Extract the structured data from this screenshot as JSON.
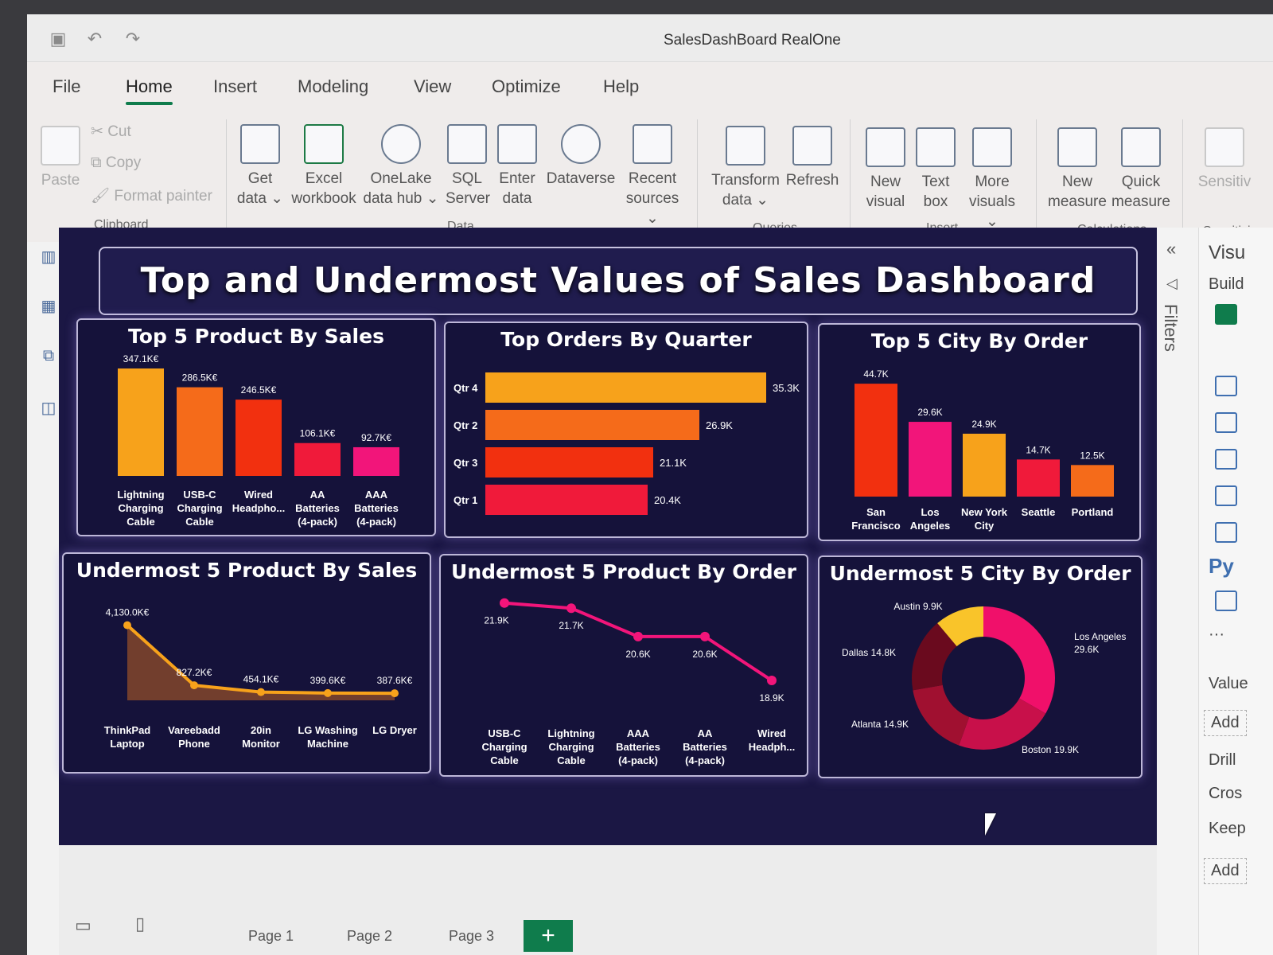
{
  "window": {
    "title": "SalesDashBoard RealOne"
  },
  "menu": [
    "File",
    "Home",
    "Insert",
    "Modeling",
    "View",
    "Optimize",
    "Help"
  ],
  "ribbon": {
    "clipboard": {
      "paste": "Paste",
      "cut": "Cut",
      "copy": "Copy",
      "format_painter": "Format painter",
      "label": "Clipboard"
    },
    "data": {
      "buttons": [
        {
          "l1": "Get",
          "l2": "data ⌄"
        },
        {
          "l1": "Excel",
          "l2": "workbook"
        },
        {
          "l1": "OneLake",
          "l2": "data hub ⌄"
        },
        {
          "l1": "SQL",
          "l2": "Server"
        },
        {
          "l1": "Enter",
          "l2": "data"
        },
        {
          "l1": "Dataverse",
          "l2": ""
        },
        {
          "l1": "Recent",
          "l2": "sources ⌄"
        }
      ],
      "label": "Data"
    },
    "queries": {
      "buttons": [
        {
          "l1": "Transform",
          "l2": "data ⌄"
        },
        {
          "l1": "Refresh",
          "l2": ""
        }
      ],
      "label": "Queries"
    },
    "insert": {
      "buttons": [
        {
          "l1": "New",
          "l2": "visual"
        },
        {
          "l1": "Text",
          "l2": "box"
        },
        {
          "l1": "More",
          "l2": "visuals ⌄"
        }
      ],
      "label": "Insert"
    },
    "calculations": {
      "buttons": [
        {
          "l1": "New",
          "l2": "measure"
        },
        {
          "l1": "Quick",
          "l2": "measure"
        }
      ],
      "label": "Calculations"
    },
    "sensitivity": {
      "button": "Sensitiv",
      "label": "Sensitivi"
    }
  },
  "dashboard": {
    "title": "Top and Undermost Values of Sales Dashboard",
    "cards": {
      "top_products": "Top 5 Product By Sales",
      "top_orders_quarter": "Top Orders By Quarter",
      "top_city": "Top 5 City By Order",
      "under_products_sales": "Undermost 5 Product By Sales",
      "under_products_order": "Undermost 5 Product By Order",
      "under_city": "Undermost 5 City By Order"
    }
  },
  "chart_data": [
    {
      "type": "bar",
      "title": "Top 5 Product By Sales",
      "categories": [
        "Lightning Charging Cable",
        "USB-C Charging Cable",
        "Wired Headpho...",
        "AA Batteries (4-pack)",
        "AAA Batteries (4-pack)"
      ],
      "values": [
        347.1,
        286.5,
        246.5,
        106.1,
        92.7
      ],
      "data_labels": [
        "347.1K€",
        "286.5K€",
        "246.5K€",
        "106.1K€",
        "92.7K€"
      ],
      "colors": [
        "#f7a21b",
        "#f56b1a",
        "#f2300f",
        "#f01a3a",
        "#f2157a"
      ],
      "ylim": [
        0,
        360
      ]
    },
    {
      "type": "bar",
      "orientation": "horizontal",
      "title": "Top Orders By Quarter",
      "categories": [
        "Qtr 4",
        "Qtr 2",
        "Qtr 3",
        "Qtr 1"
      ],
      "values": [
        35.3,
        26.9,
        21.1,
        20.4
      ],
      "data_labels": [
        "35.3K",
        "26.9K",
        "21.1K",
        "20.4K"
      ],
      "colors": [
        "#f7a21b",
        "#f56b1a",
        "#f2300f",
        "#f01a3a"
      ],
      "xlim": [
        0,
        36
      ]
    },
    {
      "type": "bar",
      "title": "Top 5 City By Order",
      "categories": [
        "San Francisco",
        "Los Angeles",
        "New York City",
        "Seattle",
        "Portland"
      ],
      "values": [
        44.7,
        29.6,
        24.9,
        14.7,
        12.5
      ],
      "data_labels": [
        "44.7K",
        "29.6K",
        "24.9K",
        "14.7K",
        "12.5K"
      ],
      "colors": [
        "#f2300f",
        "#f2157a",
        "#f7a21b",
        "#f01a3a",
        "#f56b1a"
      ],
      "ylim": [
        0,
        46
      ]
    },
    {
      "type": "area",
      "title": "Undermost 5 Product By Sales",
      "categories": [
        "ThinkPad Laptop",
        "Vareebadd Phone",
        "20in Monitor",
        "LG Washing Machine",
        "LG Dryer"
      ],
      "values": [
        4130.0,
        827.2,
        454.1,
        399.6,
        387.6
      ],
      "data_labels": [
        "4,130.0K€",
        "827.2K€",
        "454.1K€",
        "399.6K€",
        "387.6K€"
      ],
      "colors": [
        "#f7a21b"
      ],
      "ylim": [
        0,
        4200
      ]
    },
    {
      "type": "line",
      "title": "Undermost 5 Product By Order",
      "categories": [
        "USB-C Charging Cable",
        "Lightning Charging Cable",
        "AAA Batteries (4-pack)",
        "AA Batteries (4-pack)",
        "Wired Headph..."
      ],
      "values": [
        21.9,
        21.7,
        20.6,
        20.6,
        18.9
      ],
      "data_labels": [
        "21.9K",
        "21.7K",
        "20.6K",
        "20.6K",
        "18.9K"
      ],
      "colors": [
        "#f2157a"
      ],
      "ylim": [
        18.5,
        22.2
      ]
    },
    {
      "type": "pie",
      "title": "Undermost 5 City By Order",
      "labels": [
        "Los Angeles",
        "Boston",
        "Atlanta",
        "Dallas",
        "Austin"
      ],
      "values": [
        29.6,
        19.9,
        14.9,
        14.8,
        9.9
      ],
      "data_labels": [
        "Los Angeles 29.6K",
        "Boston 19.9K",
        "Atlanta 14.9K",
        "Dallas 14.8K",
        "Austin 9.9K"
      ],
      "colors": [
        "#f0106a",
        "#c8104a",
        "#a01030",
        "#6a0a1e",
        "#f9c42a"
      ]
    }
  ],
  "right_pane": {
    "filters": "Filters",
    "visuals": "Visu",
    "build": "Build",
    "values": "Value",
    "add1": "Add",
    "drill": "Drill",
    "cross": "Cros",
    "keep": "Keep",
    "add2": "Add",
    "py": "Py"
  },
  "pages": [
    "Page 1",
    "Page 2",
    "Page 3"
  ],
  "add_page": "+"
}
